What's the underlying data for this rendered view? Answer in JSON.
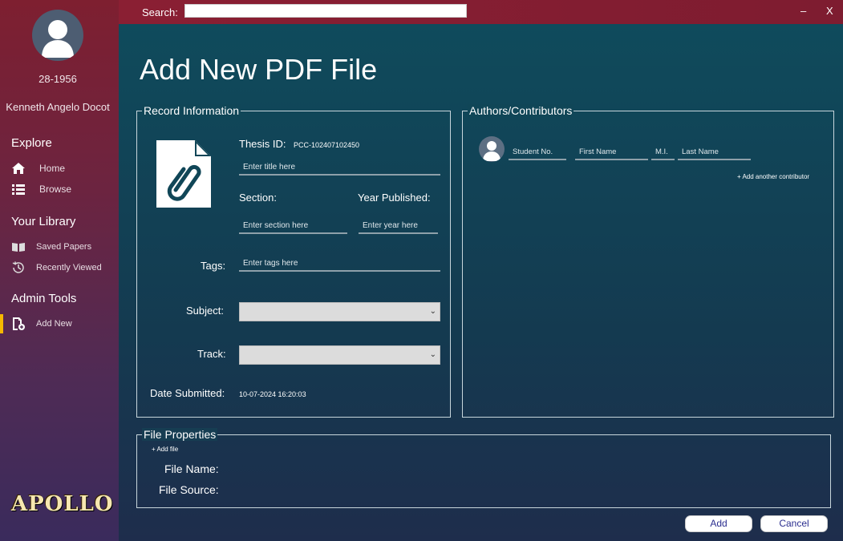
{
  "window": {
    "minimize": "–",
    "close": "X"
  },
  "search": {
    "label": "Search:",
    "value": ""
  },
  "user": {
    "id": "28-1956",
    "name": "Kenneth Angelo Docot"
  },
  "sidebar": {
    "explore_title": "Explore",
    "explore_items": [
      {
        "label": "Home",
        "icon": "home-icon"
      },
      {
        "label": "Browse",
        "icon": "list-icon"
      }
    ],
    "library_title": "Your Library",
    "library_items": [
      {
        "label": "Saved Papers",
        "icon": "book-icon"
      },
      {
        "label": "Recently Viewed",
        "icon": "history-icon"
      }
    ],
    "admin_title": "Admin Tools",
    "admin_items": [
      {
        "label": "Add New",
        "icon": "add-file-icon",
        "active": true
      }
    ],
    "brand": "APOLLO"
  },
  "page": {
    "title": "Add New PDF File"
  },
  "record": {
    "legend": "Record Information",
    "thesis_id_label": "Thesis ID:",
    "thesis_id_value": "PCC-102407102450",
    "title_placeholder": "Enter title here",
    "section_label": "Section:",
    "section_placeholder": "Enter section here",
    "year_label": "Year Published:",
    "year_placeholder": "Enter year here",
    "tags_label": "Tags:",
    "tags_placeholder": "Enter tags here",
    "subject_label": "Subject:",
    "subject_value": "",
    "track_label": "Track:",
    "track_value": "",
    "date_label": "Date Submitted:",
    "date_value": "10-07-2024 16:20:03"
  },
  "authors": {
    "legend": "Authors/Contributors",
    "student_no_placeholder": "Student No.",
    "first_name_placeholder": "First Name",
    "mi_placeholder": "M.I.",
    "last_name_placeholder": "Last Name",
    "add_contributor": "+ Add another contributor"
  },
  "file": {
    "legend": "File Properties",
    "add_file": "+ Add file",
    "name_label": "File Name:",
    "source_label": "File Source:"
  },
  "actions": {
    "add": "Add",
    "cancel": "Cancel"
  },
  "colors": {
    "accent": "#f5b800",
    "button_text": "#2b2e8f"
  }
}
